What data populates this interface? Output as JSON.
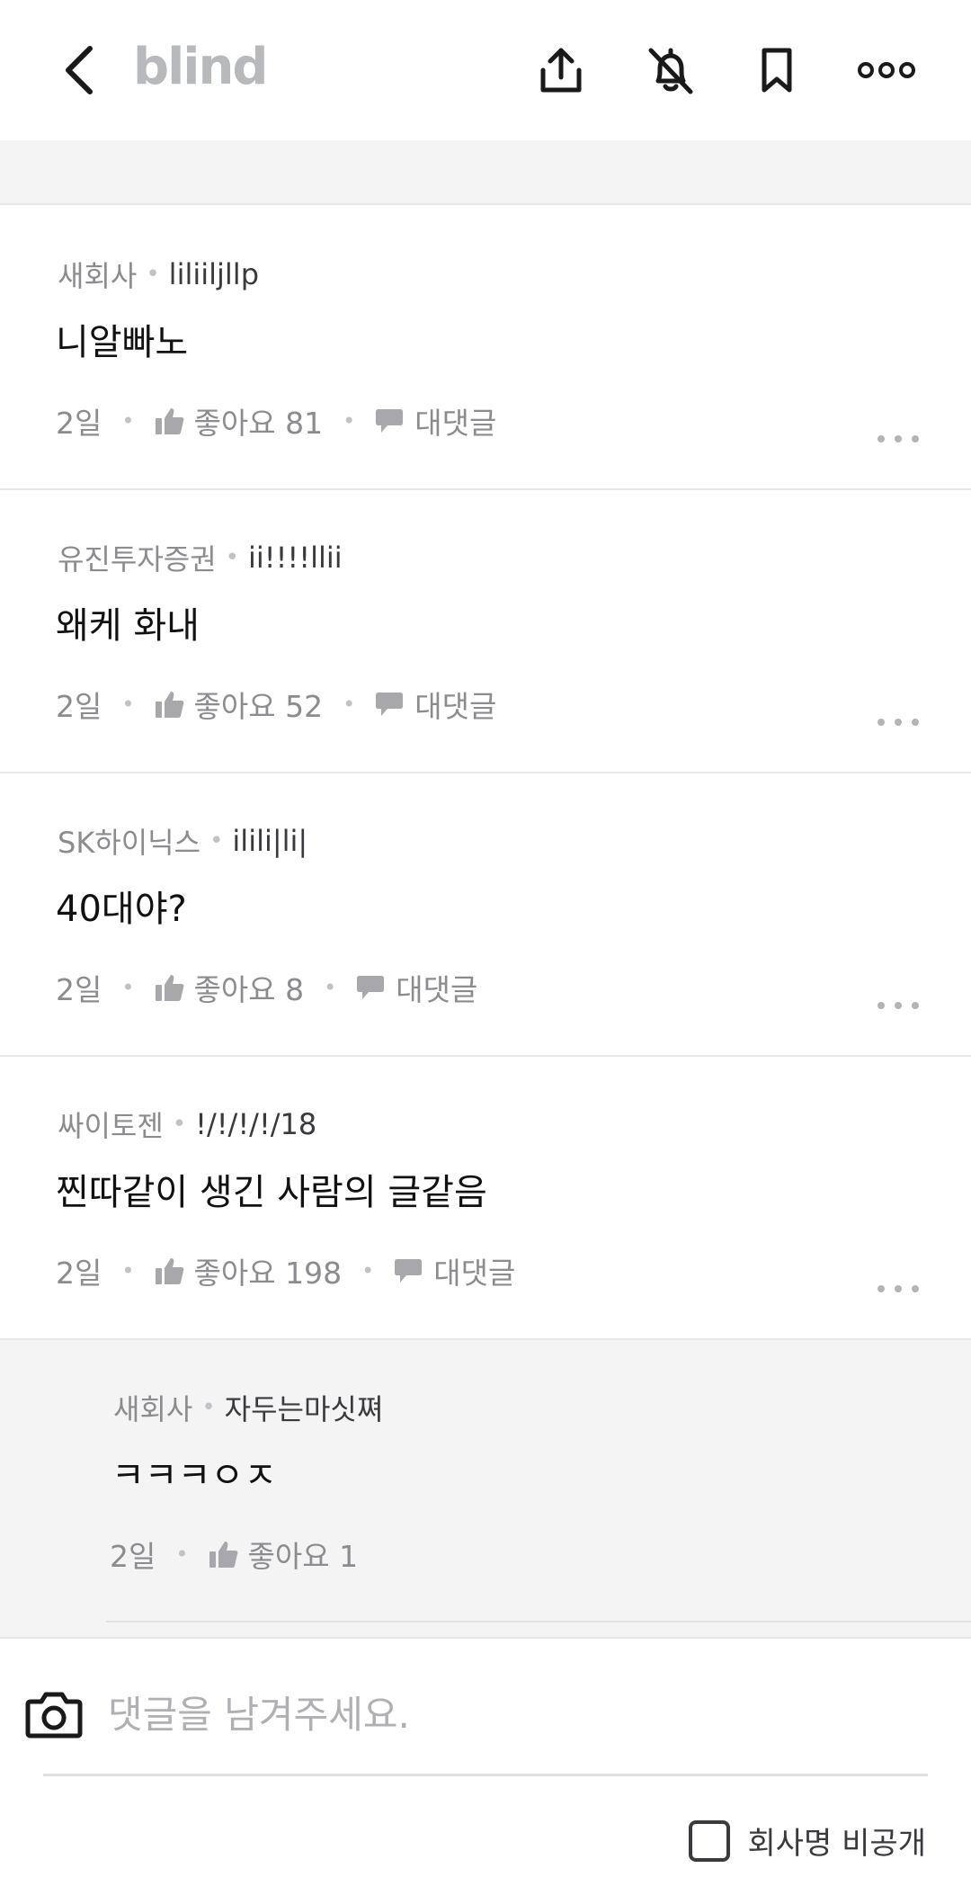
{
  "header": {
    "logo": "blind",
    "icons": [
      "back-icon",
      "share-icon",
      "bell-off-icon",
      "bookmark-icon",
      "more-icon"
    ]
  },
  "comments": [
    {
      "company": "새회사",
      "nickname": "liliiljllp",
      "body": "니알빠노",
      "time": "2일",
      "likes_label": "좋아요 81",
      "reply_label": "대댓글"
    },
    {
      "company": "유진투자증권",
      "nickname": "ii!!!!llii",
      "body": "왜케 화내",
      "time": "2일",
      "likes_label": "좋아요 52",
      "reply_label": "대댓글"
    },
    {
      "company": "SK하이닉스",
      "nickname": "ilili|li|",
      "body": "40대야?",
      "time": "2일",
      "likes_label": "좋아요 8",
      "reply_label": "대댓글"
    },
    {
      "company": "싸이토젠",
      "nickname": "!/!/!/!/18",
      "body": "찐따같이 생긴 사람의 글같음",
      "time": "2일",
      "likes_label": "좋아요 198",
      "reply_label": "대댓글"
    }
  ],
  "reply": {
    "company": "새회사",
    "nickname": "자두는마싯쪄",
    "body": "ㅋㅋㅋㅇㅈ",
    "time": "2일",
    "likes_label": "좋아요 1"
  },
  "footer": {
    "input_placeholder": "댓글을 남겨주세요.",
    "input_value": "",
    "anonymous_label": "회사명 비공개",
    "anonymous_checked": false
  },
  "colors": {
    "accent_gray": "#8c8c90",
    "logo": "#b8b9bd",
    "reply_bg": "#f4f4f5"
  }
}
